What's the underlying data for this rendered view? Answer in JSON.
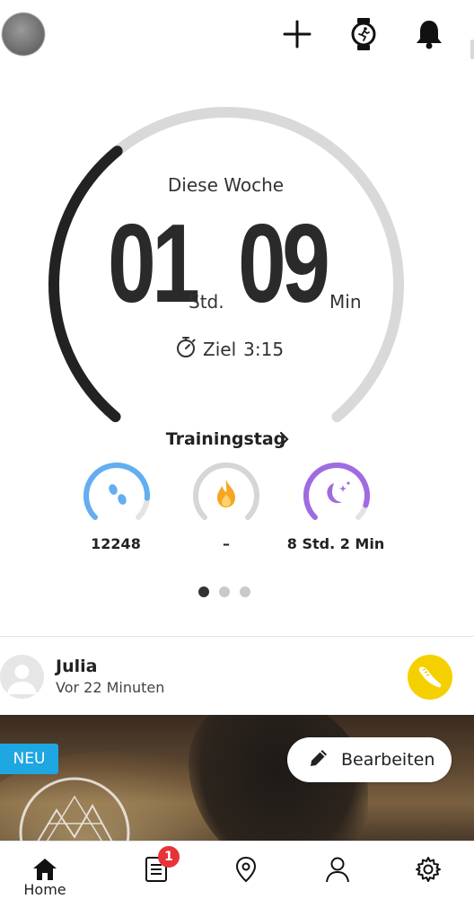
{
  "header": {
    "add_icon": "plus-icon",
    "watch_icon": "watch-running-icon",
    "bell_icon": "bell-icon"
  },
  "progress": {
    "period_label": "Diese Woche",
    "hours": "01",
    "hours_unit": "Std.",
    "minutes": "09",
    "minutes_unit": "Min",
    "goal_label": "Ziel",
    "goal_value": "3:15",
    "fraction": 0.36
  },
  "training_day": {
    "title": "Trainingstag",
    "stats": [
      {
        "icon": "steps-icon",
        "value": "12248",
        "color": "#62aef0",
        "fraction": 0.85
      },
      {
        "icon": "flame-icon",
        "value": "–",
        "color": "#d6d6d6",
        "fraction": 0.0
      },
      {
        "icon": "moon-sleep-icon",
        "value": "8 Std. 2 Min",
        "color": "#a06be0",
        "fraction": 0.9
      }
    ]
  },
  "pager": {
    "count": 3,
    "active": 0
  },
  "feed": {
    "user_name": "Julia",
    "time": "Vor 22 Minuten",
    "badge_icon": "running-shoe-icon",
    "new_badge": "NEU",
    "edit_button": "Bearbeiten"
  },
  "nav": {
    "home_label": "Home",
    "notification_count": "1"
  },
  "colors": {
    "ring_active": "#222222",
    "ring_track": "#d9d9d9",
    "accent_blue": "#1ea7e1",
    "badge_red": "#e8323a",
    "shoe_yellow": "#f5d000"
  }
}
